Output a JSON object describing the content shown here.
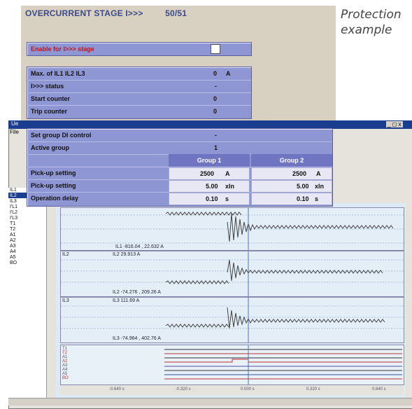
{
  "caption": [
    "Protection",
    "example"
  ],
  "stage": {
    "title": "OVERCURRENT STAGE I>>>",
    "code": "50/51",
    "enable_label": "Enable for I>>> stage"
  },
  "status_rows": [
    {
      "label": "Max. of IL1 IL2 IL3",
      "value": "0",
      "unit": "A"
    },
    {
      "label": "I>>> status",
      "value": "-",
      "unit": ""
    },
    {
      "label": "Start counter",
      "value": "0",
      "unit": ""
    },
    {
      "label": "Trip counter",
      "value": "0",
      "unit": ""
    }
  ],
  "settings": {
    "group_di_label": "Set group DI control",
    "group_di_value": "-",
    "active_group_label": "Active group",
    "active_group_value": "1",
    "group1_header": "Group 1",
    "group2_header": "Group 2",
    "rows": [
      {
        "label": "Pick-up setting",
        "g1": "2500",
        "g1_unit": "A",
        "g2": "2500",
        "g2_unit": "A"
      },
      {
        "label": "Pick-up setting",
        "g1": "5.00",
        "g1_unit": "xIn",
        "g2": "5.00",
        "g2_unit": "xIn"
      },
      {
        "label": "Operation delay",
        "g1": "0.10",
        "g1_unit": "s",
        "g2": "0.10",
        "g2_unit": "s"
      }
    ]
  },
  "window": {
    "title": "Ue",
    "menu": "File",
    "controls": "_ ◻ x",
    "signals": [
      "IL1",
      "IL2",
      "IL3",
      "I'L1",
      "I'L2",
      "I'L3",
      "T1",
      "T2",
      "A1",
      "A2",
      "A3",
      "A4",
      "A5",
      "BO"
    ],
    "traces": [
      {
        "name": "IL1",
        "readout": "IL1 -816.04 , 22.632 A"
      },
      {
        "name": "IL2",
        "readout": "IL2 29.913 A",
        "readout2": "IL2 -74.276 , 209.26 A"
      },
      {
        "name": "IL3",
        "readout": "IL3 111.69 A",
        "readout2": "IL3 -74.964 , 402.76 A"
      }
    ],
    "digital_labels": [
      "T1",
      "T2",
      "A1",
      "A2",
      "A3",
      "A4",
      "A5",
      "BO"
    ],
    "time_ticks": [
      "-0.640 s",
      "-0.320 s",
      "0.000 s",
      "0.320 s",
      "0.640 s"
    ]
  }
}
